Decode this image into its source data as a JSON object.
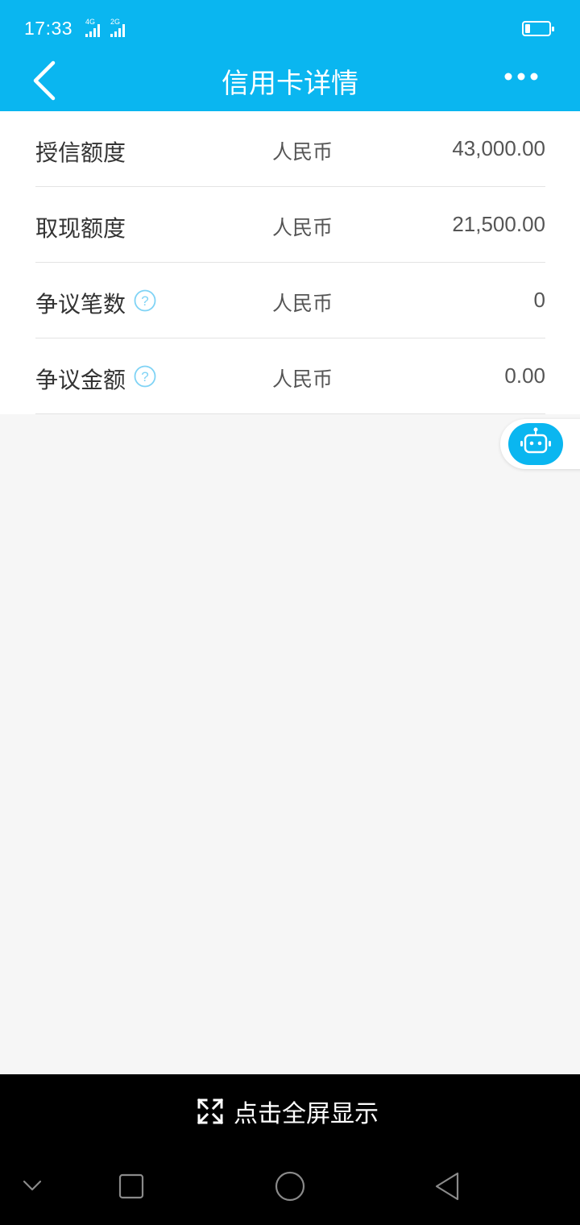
{
  "status_bar": {
    "time": "17:33",
    "networks": [
      {
        "label": "4G",
        "signal_bars": 4
      },
      {
        "label": "2G",
        "signal_bars": 4
      }
    ],
    "battery_level": 0.2,
    "icons": [
      "signal-icon",
      "battery-icon"
    ]
  },
  "header": {
    "title": "信用卡详情",
    "back_icon": "chevron-left-icon",
    "more_icon": "more-horizontal-icon"
  },
  "rows": [
    {
      "label": "授信额度",
      "has_help": false,
      "currency": "人民币",
      "value": "43,000.00"
    },
    {
      "label": "取现额度",
      "has_help": false,
      "currency": "人民币",
      "value": "21,500.00"
    },
    {
      "label": "争议笔数",
      "has_help": true,
      "currency": "人民币",
      "value": "0"
    },
    {
      "label": "争议金额",
      "has_help": true,
      "currency": "人民币",
      "value": "0.00"
    }
  ],
  "assistant": {
    "icon": "robot-icon"
  },
  "fullscreen": {
    "label": "点击全屏显示",
    "icon": "expand-arrows-icon"
  },
  "system_nav": {
    "icons": [
      "chevron-down-icon",
      "square-icon",
      "circle-icon",
      "triangle-back-icon"
    ]
  },
  "colors": {
    "primary": "#0ab6f0",
    "background": "#f6f6f6",
    "text_dark": "#333333",
    "text_mid": "#555555",
    "help_icon": "#7fd3f5"
  }
}
